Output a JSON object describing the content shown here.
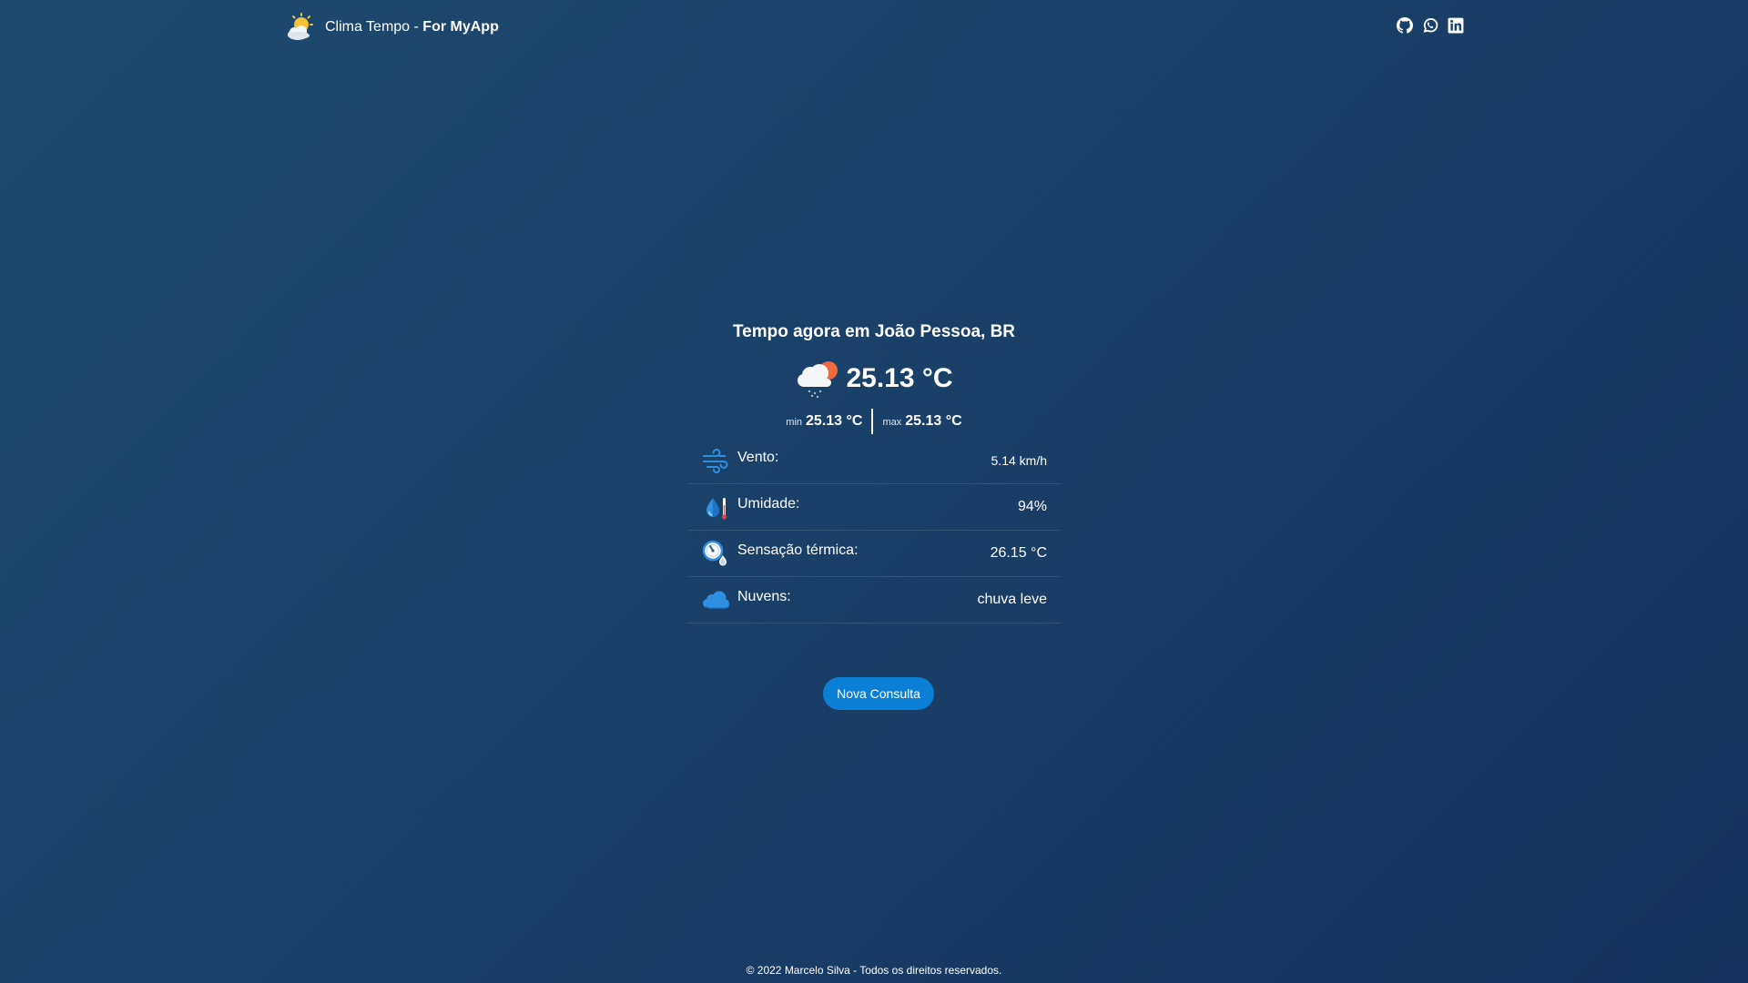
{
  "header": {
    "brand_prefix": "Clima Tempo - ",
    "brand_bold": "For MyApp",
    "social": [
      "github-icon",
      "whatsapp-icon",
      "linkedin-icon"
    ]
  },
  "weather": {
    "title": "Tempo agora em João Pessoa, BR",
    "temp": "25.13 °C",
    "condition_icon": "cloud-rain-sun-icon",
    "min_label": "min",
    "min_value": "25.13 °C",
    "max_label": "max",
    "max_value": "25.13 °C",
    "details": [
      {
        "icon": "wind-icon",
        "label": "Vento:",
        "value": "5.14 km/h"
      },
      {
        "icon": "humidity-icon",
        "label": "Umidade:",
        "value": "94%"
      },
      {
        "icon": "thermal-sensation-icon",
        "label": "Sensação térmica:",
        "value": "26.15 °C"
      },
      {
        "icon": "cloud-icon",
        "label": "Nuvens:",
        "value": "chuva leve"
      }
    ]
  },
  "actions": {
    "new_query": "Nova Consulta"
  },
  "footer": {
    "copyright": "© 2022 Marcelo Silva - Todos os direitos reservados."
  },
  "colors": {
    "background": "#1a4268",
    "button": "#0b7fd6",
    "icon_blue": "#2f8fe0"
  }
}
